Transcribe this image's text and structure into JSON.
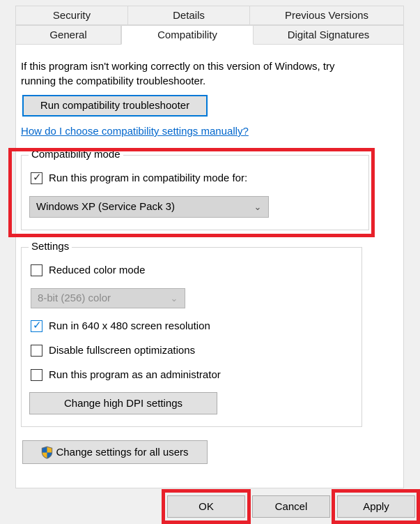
{
  "dialog": {
    "tabs_row1": [
      {
        "label": "Security",
        "active": false
      },
      {
        "label": "Details",
        "active": false
      },
      {
        "label": "Previous Versions",
        "active": false
      }
    ],
    "tabs_row2": [
      {
        "label": "General",
        "active": false
      },
      {
        "label": "Compatibility",
        "active": true
      },
      {
        "label": "Digital Signatures",
        "active": false
      }
    ]
  },
  "intro": {
    "text": "If this program isn't working correctly on this version of Windows, try running the compatibility troubleshooter.",
    "troubleshoot_button": "Run compatibility troubleshooter",
    "help_link": "How do I choose compatibility settings manually?"
  },
  "compatibility_mode": {
    "legend": "Compatibility mode",
    "checkbox_label": "Run this program in compatibility mode for:",
    "checkbox_checked": true,
    "checkbox_style": "dark",
    "selected_os": "Windows XP (Service Pack 3)",
    "dropdown_arrow": "⌄",
    "dropdown_enabled": true
  },
  "settings": {
    "legend": "Settings",
    "reduced_color_mode": {
      "label": "Reduced color mode",
      "checked": false,
      "style": "dark"
    },
    "color_depth": {
      "value": "8-bit (256) color",
      "enabled": false,
      "arrow": "⌄"
    },
    "run_640x480": {
      "label": "Run in 640 x 480 screen resolution",
      "checked": true,
      "style": "blue"
    },
    "disable_fullscreen": {
      "label": "Disable fullscreen optimizations",
      "checked": false,
      "style": "dark"
    },
    "run_as_admin": {
      "label": "Run this program as an administrator",
      "checked": false,
      "style": "dark"
    },
    "dpi_button": "Change high DPI settings"
  },
  "all_users": {
    "button_label": "Change settings for all users",
    "icon": "uac-shield-icon"
  },
  "footer": {
    "ok": "OK",
    "cancel": "Cancel",
    "apply": "Apply"
  },
  "annotations": {
    "highlight_color": "#e8202a",
    "boxes": [
      "compatibility-mode-group",
      "ok-button",
      "apply-button"
    ]
  },
  "checkmark_glyph": "✓",
  "colors": {
    "accent_blue": "#0078d7",
    "link_blue": "#0066cc",
    "annotation_red": "#e8202a",
    "button_face": "#e1e1e1",
    "dialog_background": "#f0f0f0",
    "panel_background": "#ffffff",
    "shield_blue": "#1b68b8",
    "shield_gold": "#f0b41e"
  }
}
